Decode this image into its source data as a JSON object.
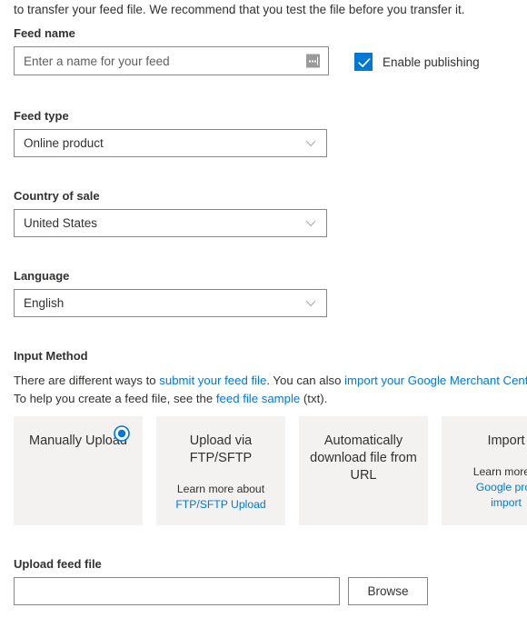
{
  "intro": {
    "text": "to transfer your feed file. We recommend that you test the file before you transfer it."
  },
  "feed_name": {
    "label": "Feed name",
    "placeholder": "Enter a name for your feed",
    "value": "",
    "affix_icon": "dots-handle-icon"
  },
  "enable_publishing": {
    "label": "Enable publishing",
    "checked": true,
    "accent_color": "#0078d4"
  },
  "feed_type": {
    "label": "Feed type",
    "selected": "Online product",
    "options": [
      "Online product"
    ]
  },
  "country_of_sale": {
    "label": "Country of sale",
    "selected": "United States",
    "options": [
      "United States"
    ]
  },
  "language": {
    "label": "Language",
    "selected": "English",
    "options": [
      "English"
    ]
  },
  "input_method": {
    "heading": "Input Method",
    "desc_line1_part1": "There are different ways to ",
    "desc_line1_link1": "submit your feed file",
    "desc_line1_part2": ". You can also ",
    "desc_line1_link2": "import your Google Merchant Center produc",
    "desc_line2_part1": "To help you create a feed file, see the ",
    "desc_line2_link1": "feed file sample",
    "desc_line2_part2": " (txt).",
    "selected_index": 0,
    "cards": [
      {
        "title": "Manually Upload",
        "sub_text": "",
        "sub_link": "",
        "selected": true
      },
      {
        "title": "Upload via FTP/SFTP",
        "sub_text": "Learn more about",
        "sub_link": "FTP/SFTP Upload",
        "selected": false
      },
      {
        "title": "Automatically download file from URL",
        "sub_text": "",
        "sub_link": "",
        "selected": false
      },
      {
        "title": "Import",
        "sub_text": "Learn more a",
        "sub_link": "Google proc",
        "sub_link2": "import",
        "selected": false
      }
    ]
  },
  "upload_feed_file": {
    "label": "Upload feed file",
    "value": "",
    "placeholder": "",
    "browse_label": "Browse"
  }
}
